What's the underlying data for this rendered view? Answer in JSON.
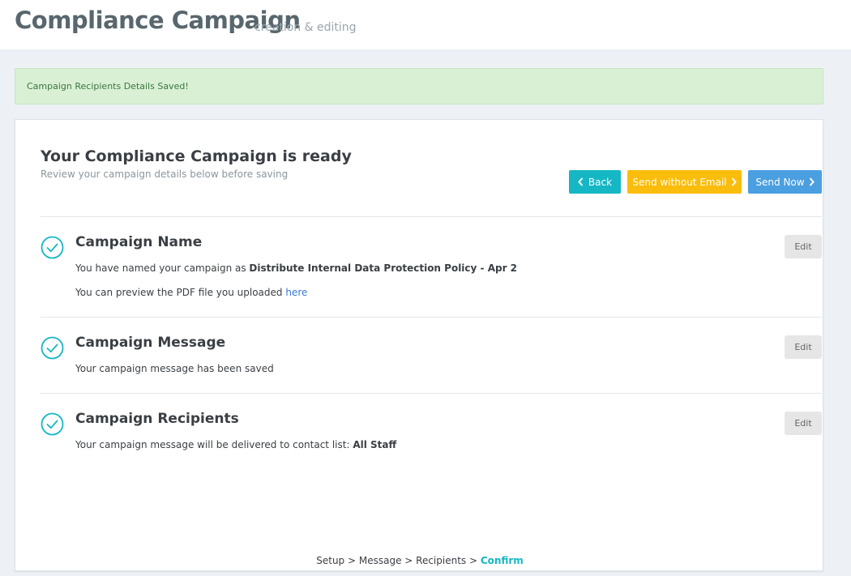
{
  "header": {
    "title": "Compliance Campaign",
    "subtitle": "creation & editing"
  },
  "alert": {
    "message": "Campaign Recipients Details Saved!"
  },
  "panel": {
    "title": "Your Compliance Campaign is ready",
    "subtitle": "Review your campaign details below before saving",
    "buttons": {
      "back": "Back",
      "send_without_email": "Send without Email",
      "send_now": "Send Now"
    }
  },
  "sections": {
    "name": {
      "title": "Campaign Name",
      "line1_prefix": "You have named your campaign as ",
      "campaign_name": "Distribute Internal Data Protection Policy - Apr 2",
      "line2_prefix": "You can preview the PDF file you uploaded ",
      "link": "here",
      "edit": "Edit"
    },
    "message": {
      "title": "Campaign Message",
      "text": "Your campaign message has been saved",
      "edit": "Edit"
    },
    "recipients": {
      "title": "Campaign Recipients",
      "text_prefix": "Your campaign message will be delivered to contact list: ",
      "contact_list": "All Staff",
      "edit": "Edit"
    }
  },
  "steps": {
    "setup": "Setup",
    "message": "Message",
    "recipients": "Recipients",
    "confirm": "Confirm",
    "separator": " > "
  },
  "colors": {
    "accent": "#15b7c4",
    "warning": "#fbbd0b",
    "primary": "#4a9fe0",
    "success_bg": "#d9f0d5"
  },
  "icons": {
    "back": "chevron-left-icon",
    "forward": "chevron-right-icon",
    "section_status": "check-circle-icon"
  }
}
